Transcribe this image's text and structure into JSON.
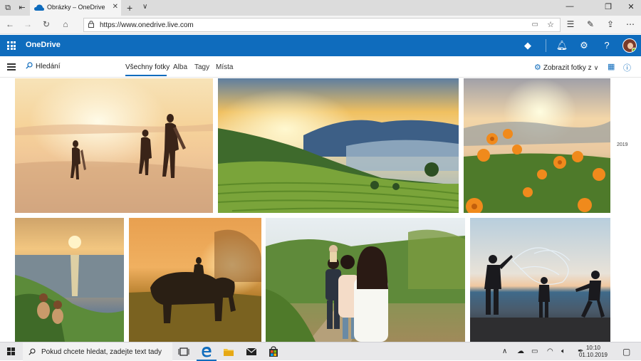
{
  "browser": {
    "tab_title": "Obrázky – OneDrive",
    "url": "https://www.onedrive.live.com",
    "tab_close_glyph": "✕",
    "new_tab_glyph": "+",
    "tab_dropdown_glyph": "∨"
  },
  "header": {
    "brand": "OneDrive"
  },
  "command_bar": {
    "search_label": "Hledání",
    "tabs": [
      "Všechny fotky",
      "Alba",
      "Tagy",
      "Místa"
    ],
    "active_tab": "Všechny fotky",
    "view_label": "Zobrazit fotky z"
  },
  "gallery": {
    "year_label": "2019",
    "photos": [
      {
        "name": "beach-surfers-sunset",
        "sky": "#f6d39a",
        "ground": "#e9c29a"
      },
      {
        "name": "tea-plantation-sunrise",
        "sky": "#f0c060",
        "ground": "#7aa43a"
      },
      {
        "name": "marigold-flowers-sunset",
        "sky": "#f3d6a8",
        "ground": "#6a8f3a"
      },
      {
        "name": "sea-cliff-sunset-kids",
        "sky": "#f2c680",
        "ground": "#5c8b3a"
      },
      {
        "name": "elephant-rider-silhouette",
        "sky": "#f0a040",
        "ground": "#8a6a20"
      },
      {
        "name": "family-walking-path",
        "sky": "#e8eef2",
        "ground": "#6f8a3a"
      },
      {
        "name": "bubbles-beach-kids",
        "sky": "#c9dce8",
        "ground": "#3a3a3a"
      }
    ]
  },
  "taskbar": {
    "search_placeholder": "Pokud chcete hledat, zadejte text tady",
    "time": "10:10",
    "date": "01.10.2019"
  },
  "colors": {
    "accent": "#0f6cbd",
    "taskbar": "#e8e8ea"
  }
}
